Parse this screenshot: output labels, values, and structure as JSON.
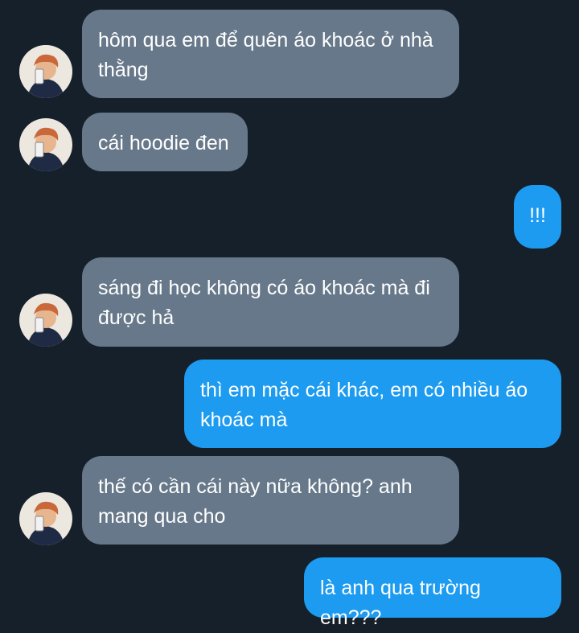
{
  "conversation": {
    "messages": [
      {
        "from": "them",
        "text": "hôm qua em để quên áo khoác ở nhà thằng"
      },
      {
        "from": "them",
        "text": "cái hoodie đen"
      },
      {
        "from": "me",
        "text": "!!!"
      },
      {
        "from": "them",
        "text": "sáng đi học không có áo khoác mà đi được hả"
      },
      {
        "from": "me",
        "text": "thì em mặc cái khác, em có nhiều áo khoác mà"
      },
      {
        "from": "them",
        "text": "thế có cần cái này nữa không? anh mang qua cho"
      },
      {
        "from": "me",
        "text": "là anh qua trường em???"
      }
    ]
  },
  "theme": {
    "background": "#16202b",
    "incoming_bubble": "#67788a",
    "outgoing_bubble": "#1c9bf0",
    "text": "#ffffff"
  },
  "icons": {
    "avatar": "contact-avatar-photo"
  }
}
